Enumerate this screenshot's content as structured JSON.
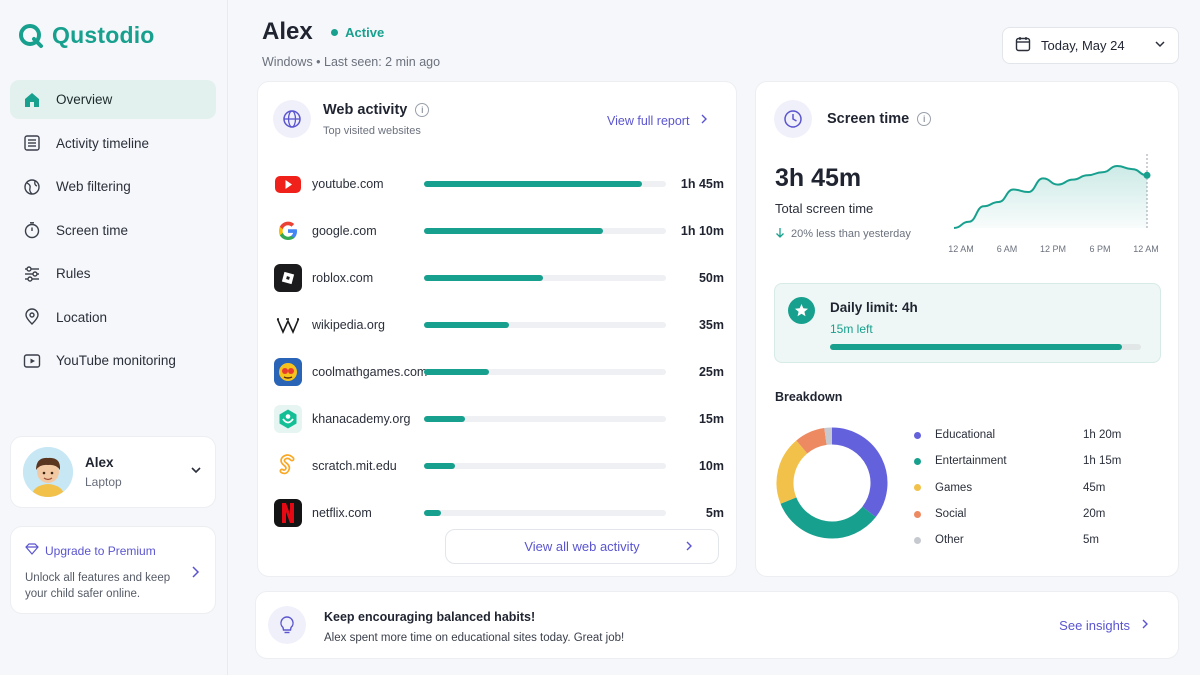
{
  "brand": {
    "name": "Qustodio",
    "color": "#18a08e",
    "accent": "#5a55cf"
  },
  "nav": [
    {
      "label": "Overview",
      "icon": "home-icon",
      "active": true
    },
    {
      "label": "Activity timeline",
      "icon": "list-icon"
    },
    {
      "label": "Web filtering",
      "icon": "globe-icon"
    },
    {
      "label": "Screen time",
      "icon": "stopwatch-icon"
    },
    {
      "label": "Rules",
      "icon": "sliders-icon"
    },
    {
      "label": "Location",
      "icon": "location-pin-icon"
    },
    {
      "label": "YouTube monitoring",
      "icon": "video-icon"
    }
  ],
  "user": {
    "name": "Alex",
    "device": "Laptop"
  },
  "premium": {
    "title": "Upgrade to Premium",
    "text": "Unlock all features and keep your child safer online."
  },
  "header": {
    "name": "Alex",
    "status": "Active",
    "subline": "Windows • Last seen: 2 min ago",
    "date": "Today, May 24"
  },
  "web": {
    "title": "Web activity",
    "subtitle": "Top visited websites",
    "report_link": "View full report",
    "view_all": "View all web activity",
    "sites": [
      {
        "name": "youtube.com",
        "time": "1h 45m",
        "fraction": 0.9
      },
      {
        "name": "google.com",
        "time": "1h 10m",
        "fraction": 0.74
      },
      {
        "name": "roblox.com",
        "time": "50m",
        "fraction": 0.49
      },
      {
        "name": "wikipedia.org",
        "time": "35m",
        "fraction": 0.35
      },
      {
        "name": "coolmathgames.com",
        "time": "25m",
        "fraction": 0.27
      },
      {
        "name": "khanacademy.org",
        "time": "15m",
        "fraction": 0.17
      },
      {
        "name": "scratch.mit.edu",
        "time": "10m",
        "fraction": 0.13
      },
      {
        "name": "netflix.com",
        "time": "5m",
        "fraction": 0.07
      }
    ]
  },
  "screen": {
    "title": "Screen time",
    "total": "3h 45m",
    "total_label": "Total screen time",
    "comparison": "20% less than yesterday",
    "limit_title": "Daily limit: 4h",
    "limit_left": "15m left",
    "limit_fraction": 0.94,
    "breakdown_title": "Breakdown"
  },
  "chart_data": [
    {
      "type": "area",
      "x": [
        "12 AM",
        "6 AM",
        "12 PM",
        "6 PM",
        "12 AM"
      ],
      "values": [
        0.0,
        0.1,
        0.35,
        0.42,
        0.62,
        0.58,
        0.8,
        0.7,
        0.78,
        0.85,
        0.9,
        1.0,
        0.95,
        0.85
      ],
      "grid": false
    },
    {
      "type": "pie",
      "categories": [
        "Educational",
        "Entertainment",
        "Games",
        "Social",
        "Other"
      ],
      "labels": [
        "1h 20m",
        "1h 15m",
        "45m",
        "20m",
        "5m"
      ],
      "values": [
        80,
        75,
        45,
        20,
        5
      ],
      "colors": [
        "#6461dc",
        "#18a08e",
        "#f2c14a",
        "#ee8a62",
        "#c6c9cf"
      ]
    }
  ],
  "tip": {
    "title": "Keep encouraging balanced habits!",
    "text": "Alex spent more time on educational sites today. Great job!",
    "link": "See insights"
  }
}
